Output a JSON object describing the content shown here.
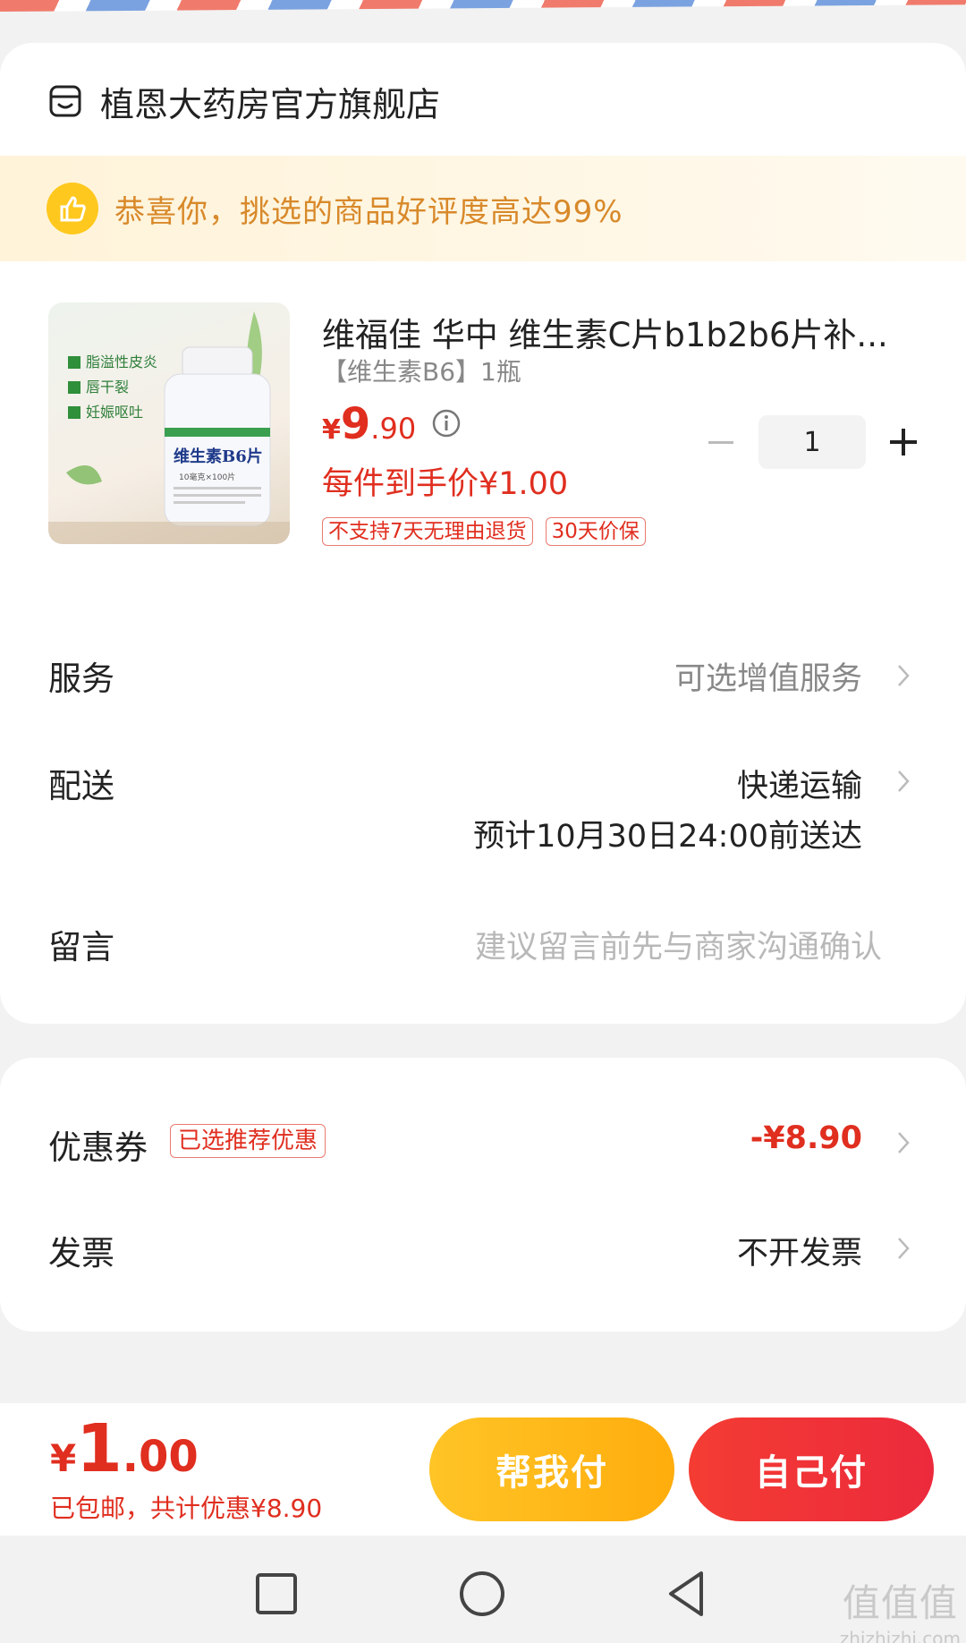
{
  "store": {
    "name": "植恩大药房官方旗舰店",
    "icon": "shop-icon"
  },
  "banner": {
    "text": "恭喜你，挑选的商品好评度高达99%",
    "icon": "thumbs-up-icon"
  },
  "product": {
    "image_texts": [
      "脂溢性皮炎",
      "唇干裂",
      "妊娠呕吐",
      "维生素B6片",
      "10毫克×100片"
    ],
    "title": "维福佳 华中 维生素C片b1b2b6片补...",
    "variant": "【维生素B6】1瓶",
    "price_symbol": "¥",
    "price_int": "9",
    "price_dec": ".90",
    "final_price": "每件到手价¥1.00",
    "tags": [
      "不支持7天无理由退货",
      "30天价保"
    ],
    "quantity": "1"
  },
  "rows": {
    "service": {
      "label": "服务",
      "value": "可选增值服务"
    },
    "delivery": {
      "label": "配送",
      "value": "快递运输",
      "eta": "预计10月30日24:00前送达"
    },
    "message": {
      "label": "留言",
      "placeholder": "建议留言前先与商家沟通确认"
    }
  },
  "coupon": {
    "label": "优惠券",
    "badge": "已选推荐优惠",
    "value": "-¥8.90"
  },
  "invoice": {
    "label": "发票",
    "value": "不开发票"
  },
  "bottom": {
    "total_symbol": "¥",
    "total_int": "1",
    "total_dec": ".00",
    "subtext": "已包邮，共计优惠¥8.90",
    "help_pay": "帮我付",
    "self_pay": "自己付"
  },
  "watermark": {
    "big": "值值值",
    "small": "zhizhizhi.com"
  },
  "colors": {
    "accent": "#e02e1f",
    "banner_text": "#d8892a",
    "help_btn": "#ffb81a",
    "self_btn": "#f03436"
  }
}
